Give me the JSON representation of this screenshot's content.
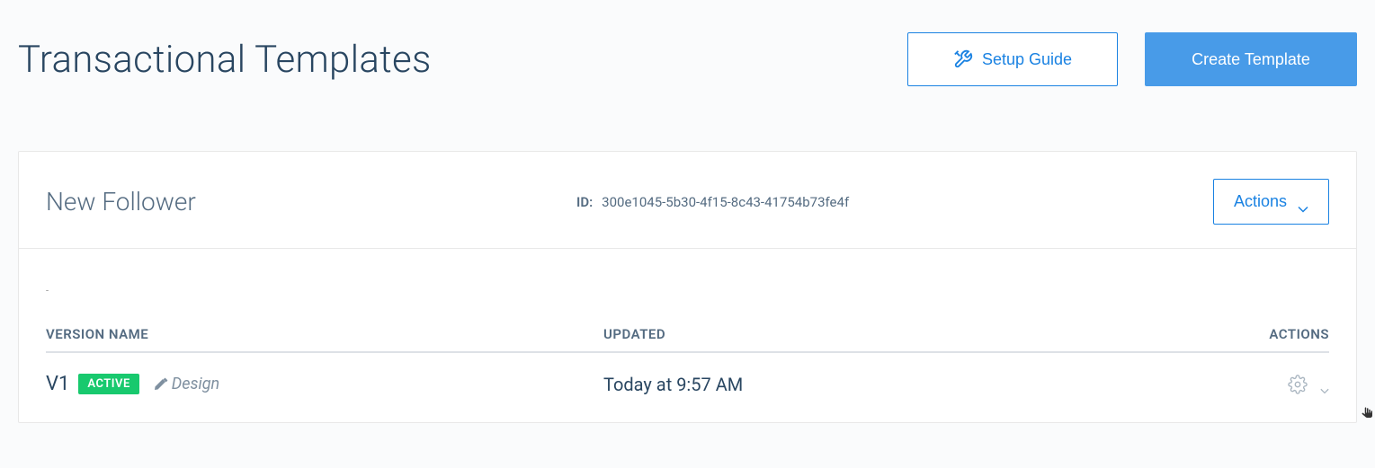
{
  "header": {
    "title": "Transactional Templates",
    "setup_guide_label": "Setup Guide",
    "create_template_label": "Create Template"
  },
  "template": {
    "name": "New Follower",
    "id_label": "ID:",
    "id_value": "300e1045-5b30-4f15-8c43-41754b73fe4f",
    "actions_label": "Actions"
  },
  "table": {
    "headers": {
      "version_name": "VERSION NAME",
      "updated": "UPDATED",
      "actions": "ACTIONS"
    },
    "rows": [
      {
        "name": "V1",
        "status_badge": "ACTIVE",
        "type": "Design",
        "updated": "Today at 9:57 AM"
      }
    ]
  },
  "colors": {
    "primary_blue": "#1a82e2",
    "button_blue": "#489be8",
    "green_badge": "#18c96e",
    "text_dark": "#294661",
    "text_muted": "#546b81"
  }
}
